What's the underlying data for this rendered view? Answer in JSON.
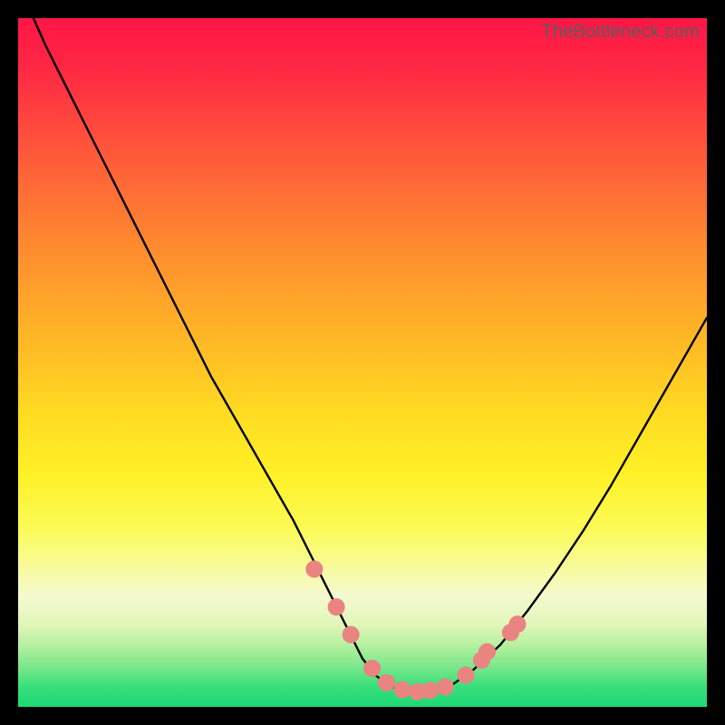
{
  "watermark": "TheBottleneck.com",
  "colors": {
    "frame": "#000000",
    "curve_stroke": "#000000",
    "marker_fill": "#e98480",
    "marker_stroke": "#e98480"
  },
  "chart_data": {
    "type": "line",
    "title": "",
    "xlabel": "",
    "ylabel": "",
    "xlim": [
      0,
      100
    ],
    "ylim": [
      0,
      100
    ],
    "grid": false,
    "legend": null,
    "series": [
      {
        "name": "bottleneck-curve",
        "x": [
          0,
          4,
          8,
          12,
          16,
          20,
          24,
          28,
          32,
          36,
          40,
          43,
          46,
          48,
          50,
          52,
          54,
          56,
          58,
          60,
          63,
          66,
          70,
          74,
          78,
          82,
          86,
          90,
          94,
          98,
          100
        ],
        "y": [
          105,
          96,
          88,
          80,
          72,
          64,
          56,
          48,
          41,
          34,
          27,
          21,
          15,
          11,
          7,
          4.5,
          3,
          2.4,
          2.2,
          2.4,
          3.2,
          5.3,
          9.0,
          14,
          19.5,
          25.5,
          32,
          39,
          46,
          53,
          56.5
        ]
      }
    ],
    "markers": [
      {
        "x": 43.0,
        "y": 20.0
      },
      {
        "x": 46.2,
        "y": 14.5
      },
      {
        "x": 48.3,
        "y": 10.5
      },
      {
        "x": 51.4,
        "y": 5.6
      },
      {
        "x": 53.5,
        "y": 3.5
      },
      {
        "x": 55.8,
        "y": 2.5
      },
      {
        "x": 58.0,
        "y": 2.2
      },
      {
        "x": 59.8,
        "y": 2.4
      },
      {
        "x": 62.0,
        "y": 2.9
      },
      {
        "x": 65.0,
        "y": 4.6
      },
      {
        "x": 67.3,
        "y": 6.8
      },
      {
        "x": 68.1,
        "y": 8.0
      },
      {
        "x": 71.5,
        "y": 10.8
      },
      {
        "x": 72.5,
        "y": 12.0
      }
    ]
  }
}
